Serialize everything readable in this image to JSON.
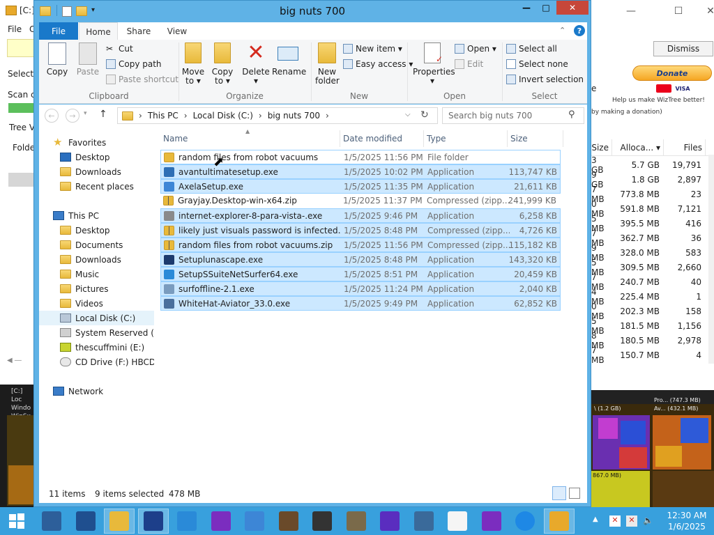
{
  "colors": {
    "explorer_border": "#5fb2e6",
    "selection": "#cce8ff",
    "taskbar": "#38a0dd",
    "file_tab": "#1979ca"
  },
  "wiztree": {
    "title_prefix": "[C:]",
    "menu_file": "File",
    "menu_c": "C",
    "select_label": "Select:",
    "scan_label": "Scan c",
    "tree_label": "Tree V",
    "folder_label": "Folde",
    "dismiss": "Dismiss",
    "donate": "Donate",
    "help_text": "Help us make WizTree better!",
    "by_making": "by making a donation)",
    "e_char": "e",
    "headers": {
      "size": "Size",
      "allocated": "Alloca...",
      "files": "Files"
    },
    "rows": [
      {
        "size": "3 GB",
        "alloc": "5.7 GB",
        "files": "19,791"
      },
      {
        "size": "9 GB",
        "alloc": "1.8 GB",
        "files": "2,897"
      },
      {
        "size": "7 MB",
        "alloc": "773.8 MB",
        "files": "23"
      },
      {
        "size": "0 MB",
        "alloc": "591.8 MB",
        "files": "7,121"
      },
      {
        "size": "5 MB",
        "alloc": "395.5 MB",
        "files": "416"
      },
      {
        "size": "7 MB",
        "alloc": "362.7 MB",
        "files": "36"
      },
      {
        "size": "9 MB",
        "alloc": "328.0 MB",
        "files": "583"
      },
      {
        "size": "5 MB",
        "alloc": "309.5 MB",
        "files": "2,660"
      },
      {
        "size": "7 MB",
        "alloc": "240.7 MB",
        "files": "40"
      },
      {
        "size": "4 MB",
        "alloc": "225.4 MB",
        "files": "1"
      },
      {
        "size": "0 MB",
        "alloc": "202.3 MB",
        "files": "158"
      },
      {
        "size": "5 MB",
        "alloc": "181.5 MB",
        "files": "1,156"
      },
      {
        "size": "8 MB",
        "alloc": "180.5 MB",
        "files": "2,978"
      },
      {
        "size": "7 MB",
        "alloc": "150.7 MB",
        "files": "4"
      }
    ],
    "treemap_labels": {
      "a": "\\ (1.2 GB)",
      "b": "Pro... (747.3 MB)",
      "c": "Av... (432.1 MB)",
      "d": "867.0 MB)"
    },
    "left_labels": [
      "[C:] Loc",
      "Windo",
      "WinSx"
    ]
  },
  "explorer": {
    "title": "big nuts 700",
    "tabs": {
      "file": "File",
      "home": "Home",
      "share": "Share",
      "view": "View"
    },
    "ribbon": {
      "copy": "Copy",
      "paste": "Paste",
      "cut": "Cut",
      "copy_path": "Copy path",
      "paste_shortcut": "Paste shortcut",
      "move_to": "Move",
      "move_to2": "to ▾",
      "copy_to": "Copy",
      "copy_to2": "to ▾",
      "delete": "Delete",
      "delete2": "▾",
      "rename": "Rename",
      "new_folder": "New",
      "new_folder2": "folder",
      "new_item": "New item ▾",
      "easy_access": "Easy access ▾",
      "properties": "Properties",
      "properties2": "▾",
      "open": "Open ▾",
      "edit": "Edit",
      "select_all": "Select all",
      "select_none": "Select none",
      "invert_selection": "Invert selection",
      "groups": {
        "clipboard": "Clipboard",
        "organize": "Organize",
        "new": "New",
        "open": "Open",
        "select": "Select"
      }
    },
    "address": {
      "this_pc": "This PC",
      "drive": "Local Disk (C:)",
      "folder": "big nuts 700",
      "sep": "›"
    },
    "search_placeholder": "Search big nuts 700",
    "nav": {
      "favorites": "Favorites",
      "desktop": "Desktop",
      "downloads": "Downloads",
      "recent": "Recent places",
      "this_pc": "This PC",
      "pc_desktop": "Desktop",
      "documents": "Documents",
      "pc_downloads": "Downloads",
      "music": "Music",
      "pictures": "Pictures",
      "videos": "Videos",
      "local_disk": "Local Disk (C:)",
      "system_reserved": "System Reserved (D:",
      "thescuffmini": "thescuffmini (E:)",
      "cd_drive": "CD Drive (F:) HBCD_",
      "network": "Network"
    },
    "columns": {
      "name": "Name",
      "date": "Date modified",
      "type": "Type",
      "size": "Size"
    },
    "files": [
      {
        "name": "random files from robot vacuums",
        "date": "1/5/2025 11:56 PM",
        "type": "File folder",
        "size": "",
        "icon": "folder-icon",
        "selected": false,
        "color": "#e8b93b"
      },
      {
        "name": "avantultimatesetup.exe",
        "date": "1/5/2025 10:02 PM",
        "type": "Application",
        "size": "113,747 KB",
        "icon": "avant-icon",
        "selected": true,
        "color": "#2e6fb5"
      },
      {
        "name": "AxelaSetup.exe",
        "date": "1/5/2025 11:35 PM",
        "type": "Application",
        "size": "21,611 KB",
        "icon": "axela-icon",
        "selected": true,
        "color": "#3d86d6"
      },
      {
        "name": "Grayjay.Desktop-win-x64.zip",
        "date": "1/5/2025 11:37 PM",
        "type": "Compressed (zipp...",
        "size": "241,999 KB",
        "icon": "zip-icon",
        "selected": false,
        "color": "#e8b93b"
      },
      {
        "name": "internet-explorer-8-para-vista-.exe",
        "date": "1/5/2025 9:46 PM",
        "type": "Application",
        "size": "6,258 KB",
        "icon": "exe-icon",
        "selected": true,
        "color": "#8a8a8a"
      },
      {
        "name": "likely just visuals password is infected.zip",
        "date": "1/5/2025 8:48 PM",
        "type": "Compressed (zipp...",
        "size": "4,726 KB",
        "icon": "zip-icon",
        "selected": true,
        "color": "#e8b93b"
      },
      {
        "name": "random files from robot vacuums.zip",
        "date": "1/5/2025 11:56 PM",
        "type": "Compressed (zipp...",
        "size": "115,182 KB",
        "icon": "zip-icon",
        "selected": true,
        "color": "#e8b93b"
      },
      {
        "name": "Setuplunascape.exe",
        "date": "1/5/2025 8:48 PM",
        "type": "Application",
        "size": "143,320 KB",
        "icon": "lunascape-icon",
        "selected": true,
        "color": "#1d3b6e"
      },
      {
        "name": "SetupSSuiteNetSurfer64.exe",
        "date": "1/5/2025 8:51 PM",
        "type": "Application",
        "size": "20,459 KB",
        "icon": "netsurfer-icon",
        "selected": true,
        "color": "#2a8ad8"
      },
      {
        "name": "surfoffline-2.1.exe",
        "date": "1/5/2025 11:24 PM",
        "type": "Application",
        "size": "2,040 KB",
        "icon": "surfoffline-icon",
        "selected": true,
        "color": "#7a9cbf"
      },
      {
        "name": "WhiteHat-Aviator_33.0.exe",
        "date": "1/5/2025 9:49 PM",
        "type": "Application",
        "size": "62,852 KB",
        "icon": "aviator-icon",
        "selected": true,
        "color": "#4a6f9c"
      }
    ],
    "status": {
      "items": "11 items",
      "selected": "9 items selected",
      "size": "478 MB"
    }
  },
  "taskbar": {
    "apps": [
      "server-manager-icon",
      "powershell-icon",
      "file-explorer-icon",
      "avant-browser-icon",
      "netsurfer-icon",
      "yahoo-icon",
      "axela-icon",
      "minecraft-icon",
      "media-icon",
      "gimp-icon",
      "virus-icon",
      "monitor-icon",
      "blank-file-icon",
      "yahoo-messenger-icon",
      "internet-explorer-icon",
      "wiztree-icon"
    ],
    "time": "12:30 AM",
    "date": "1/6/2025"
  }
}
